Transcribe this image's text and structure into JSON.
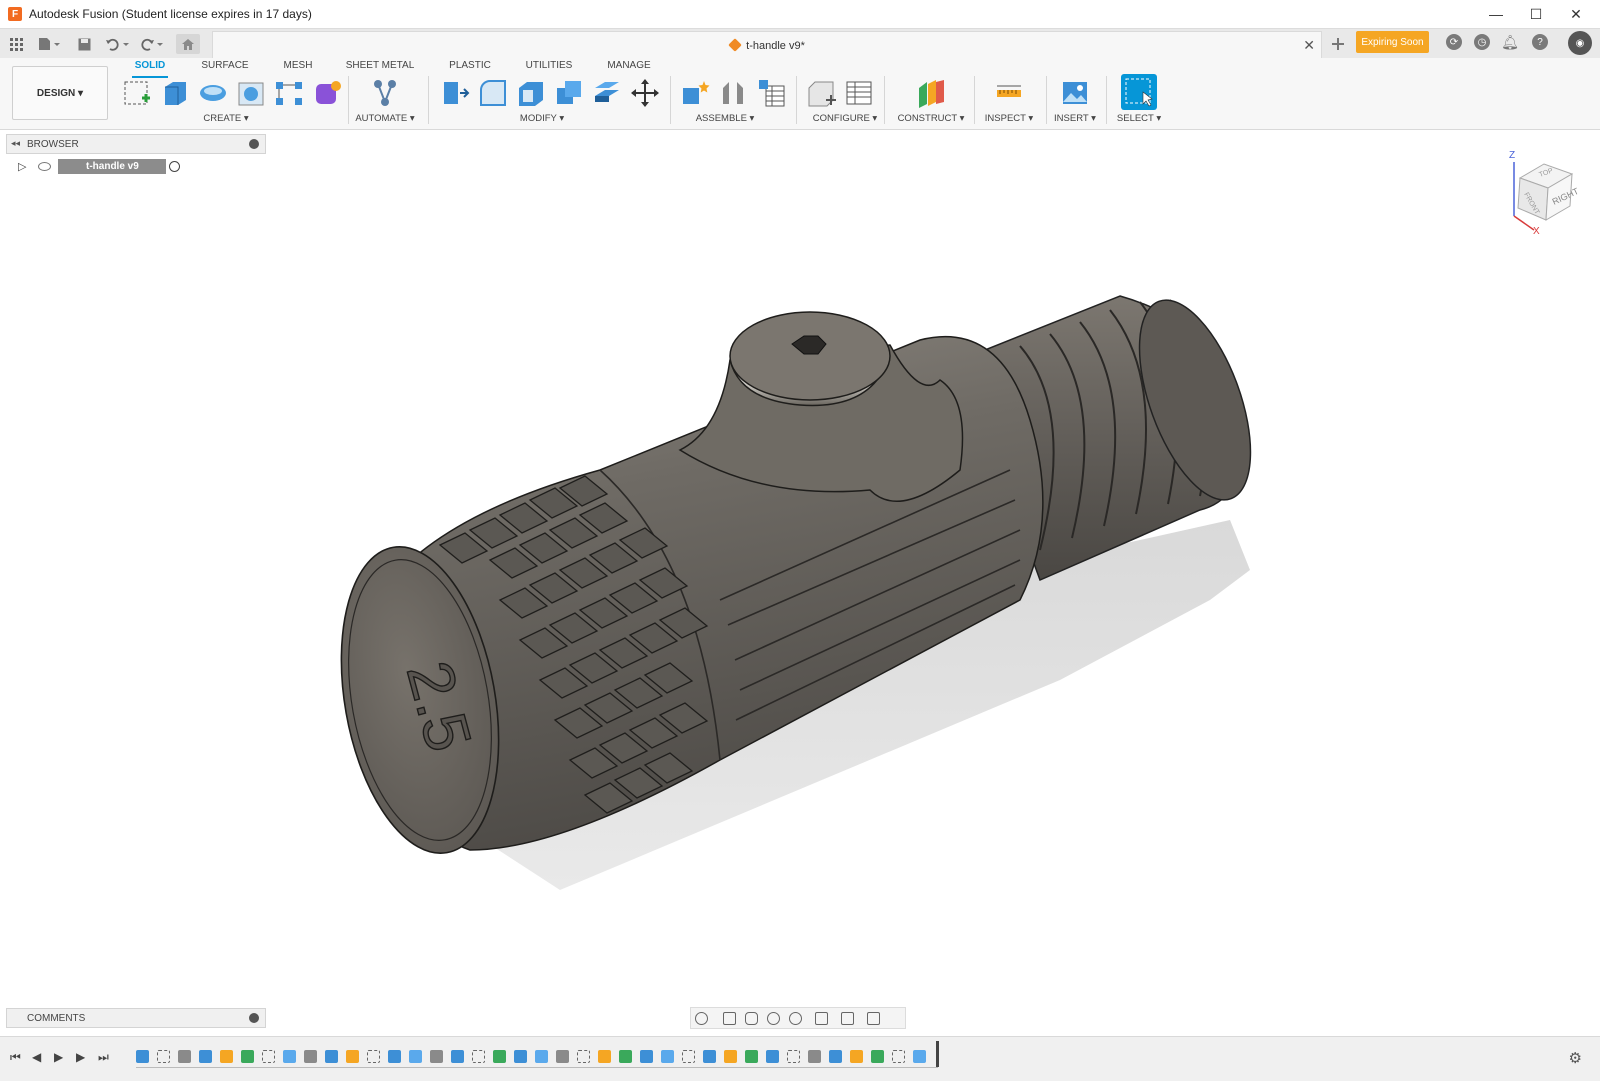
{
  "window": {
    "title": "Autodesk Fusion (Student license expires in 17 days)",
    "logo_letter": "F",
    "minimize": "—",
    "maximize": "☐",
    "close": "✕"
  },
  "document_tab": {
    "title": "t-handle v9*",
    "close": "✕"
  },
  "header": {
    "expiring_label": "Expiring Soon"
  },
  "ribbon": {
    "workspace": "DESIGN ▾",
    "tabs": [
      {
        "label": "SOLID"
      },
      {
        "label": "SURFACE"
      },
      {
        "label": "MESH"
      },
      {
        "label": "SHEET METAL"
      },
      {
        "label": "PLASTIC"
      },
      {
        "label": "UTILITIES"
      },
      {
        "label": "MANAGE"
      }
    ],
    "groups": [
      {
        "label": "CREATE ▾"
      },
      {
        "label": "AUTOMATE ▾"
      },
      {
        "label": "MODIFY ▾"
      },
      {
        "label": "ASSEMBLE ▾"
      },
      {
        "label": "CONFIGURE ▾"
      },
      {
        "label": "CONSTRUCT ▾"
      },
      {
        "label": "INSPECT ▾"
      },
      {
        "label": "INSERT ▾"
      },
      {
        "label": "SELECT ▾"
      }
    ]
  },
  "browser": {
    "label": "BROWSER",
    "root_node": "t-handle v9"
  },
  "model": {
    "end_text": "2.5"
  },
  "viewcube": {
    "face_right": "RIGHT",
    "face_top": "TOP",
    "face_front": "FRONT",
    "axis_z": "Z",
    "axis_x": "X"
  },
  "comments": {
    "label": "COMMENTS"
  },
  "colors": {
    "accent": "#0696d7",
    "expiring": "#f5a623",
    "model_body": "#6e6a64",
    "background": "#ffffff"
  },
  "icons": [
    "grid-menu-icon",
    "file-icon",
    "save-icon",
    "undo-icon",
    "redo-icon",
    "home-icon",
    "plus-icon",
    "sync-icon",
    "clock-icon",
    "bell-icon",
    "help-icon",
    "gear-icon",
    "play-icon",
    "step-back-icon",
    "step-forward-icon"
  ]
}
